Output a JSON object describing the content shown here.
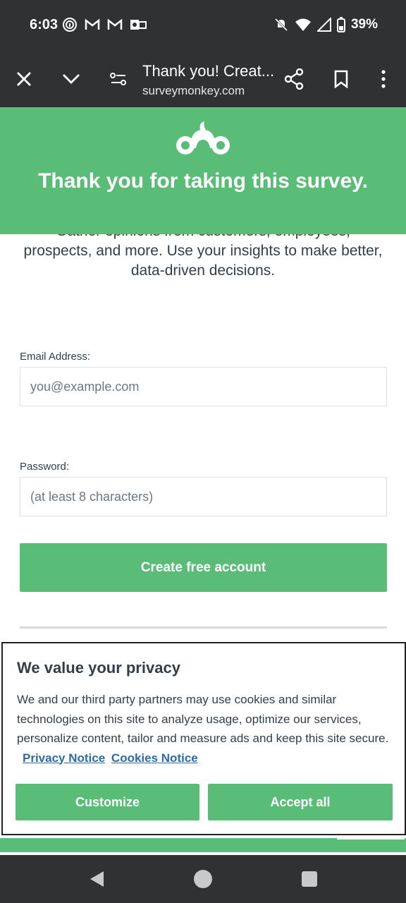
{
  "status_bar": {
    "time": "6:03",
    "battery_percent": "39%",
    "left_icons": [
      "fingerprint-icon",
      "gmail-icon",
      "gmail-icon",
      "outlook-icon"
    ],
    "right_icons": [
      "mute-icon",
      "wifi-icon",
      "signal-icon",
      "battery-icon"
    ]
  },
  "browser": {
    "title": "Thank you! Creat...",
    "url": "surveymonkey.com"
  },
  "hero": {
    "title": "Thank you for taking this survey."
  },
  "intro": {
    "partial_line": "Gather opinions from customers, employees,",
    "text": "prospects, and more. Use your insights to make better, data-driven decisions."
  },
  "form": {
    "email_label": "Email Address:",
    "email_placeholder": "you@example.com",
    "password_label": "Password:",
    "password_placeholder": "(at least 8 characters)",
    "submit_label": "Create free account"
  },
  "privacy": {
    "title": "We value your privacy",
    "body": "We and our third party partners may use cookies and similar technologies on this site to analyze usage, optimize our services, personalize content, tailor and measure ads and keep this site secure.",
    "privacy_link": "Privacy Notice",
    "cookies_link": "Cookies Notice",
    "customize_label": "Customize",
    "accept_label": "Accept all"
  },
  "colors": {
    "brand_green": "#59bd77",
    "dark_bar": "#303133",
    "text": "#333e48",
    "link": "#2e6aa3"
  }
}
